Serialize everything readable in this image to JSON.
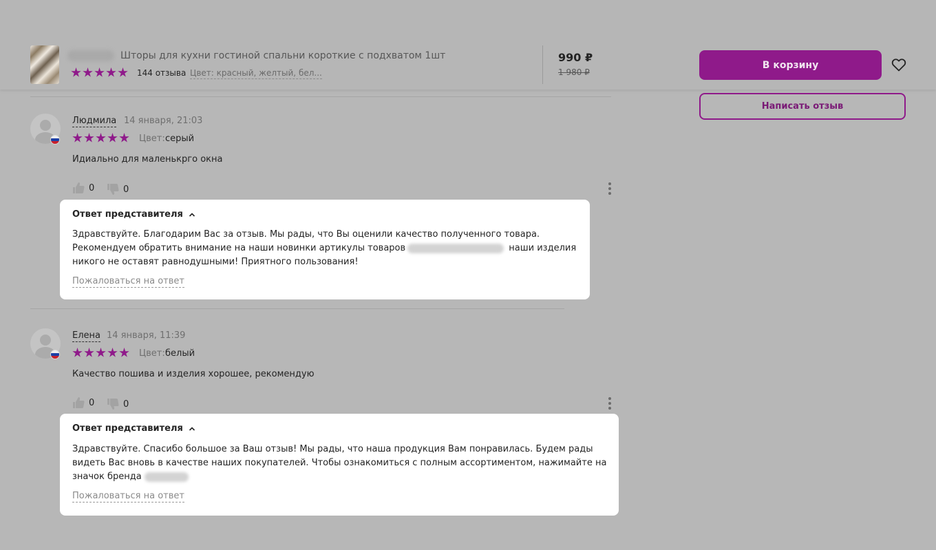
{
  "product": {
    "title": "Шторы для кухни гостиной спальни короткие с подхватом 1шт",
    "reviews_count": "144 отзыва",
    "color_info": "Цвет: красный, желтый, бел...",
    "price": "990 ₽",
    "old_price": "1 980 ₽",
    "rating": 5
  },
  "actions": {
    "cart_label": "В корзину",
    "write_review_label": "Написать отзыв"
  },
  "reviews": [
    {
      "author": "Людмила",
      "date": "14 января, 21:03",
      "color_label": "Цвет:",
      "color": "серый",
      "text": "Идиально для маленькрго окна",
      "likes": "0",
      "dislikes": "0",
      "reply": {
        "title": "Ответ представителя",
        "text_part1": "Здравствуйте. Благодарим Вас за отзыв. Мы рады, что Вы оценили качество полученного товара. Рекомендуем обратить внимание на наши новинки артикулы товаров",
        "text_part2": " наши изделия никого не оставят равнодушными! Приятного пользования!",
        "complain": "Пожаловаться на ответ"
      }
    },
    {
      "author": "Елена",
      "date": "14 января, 11:39",
      "color_label": "Цвет:",
      "color": "белый",
      "text": "Качество пошива и изделия хорошее, рекомендую",
      "likes": "0",
      "dislikes": "0",
      "reply": {
        "title": "Ответ представителя",
        "text_part1": "Здравствуйте. Спасибо большое за Ваш отзыв! Мы рады, что наша продукция Вам понравилась. Будем рады видеть Вас вновь в качестве наших покупателей. Чтобы ознакомиться с полным ассортиментом, нажимайте на значок бренда",
        "complain": "Пожаловаться на ответ"
      }
    }
  ],
  "colors": {
    "accent": "#8f1a8a",
    "overlay": "#b7b7b7"
  }
}
